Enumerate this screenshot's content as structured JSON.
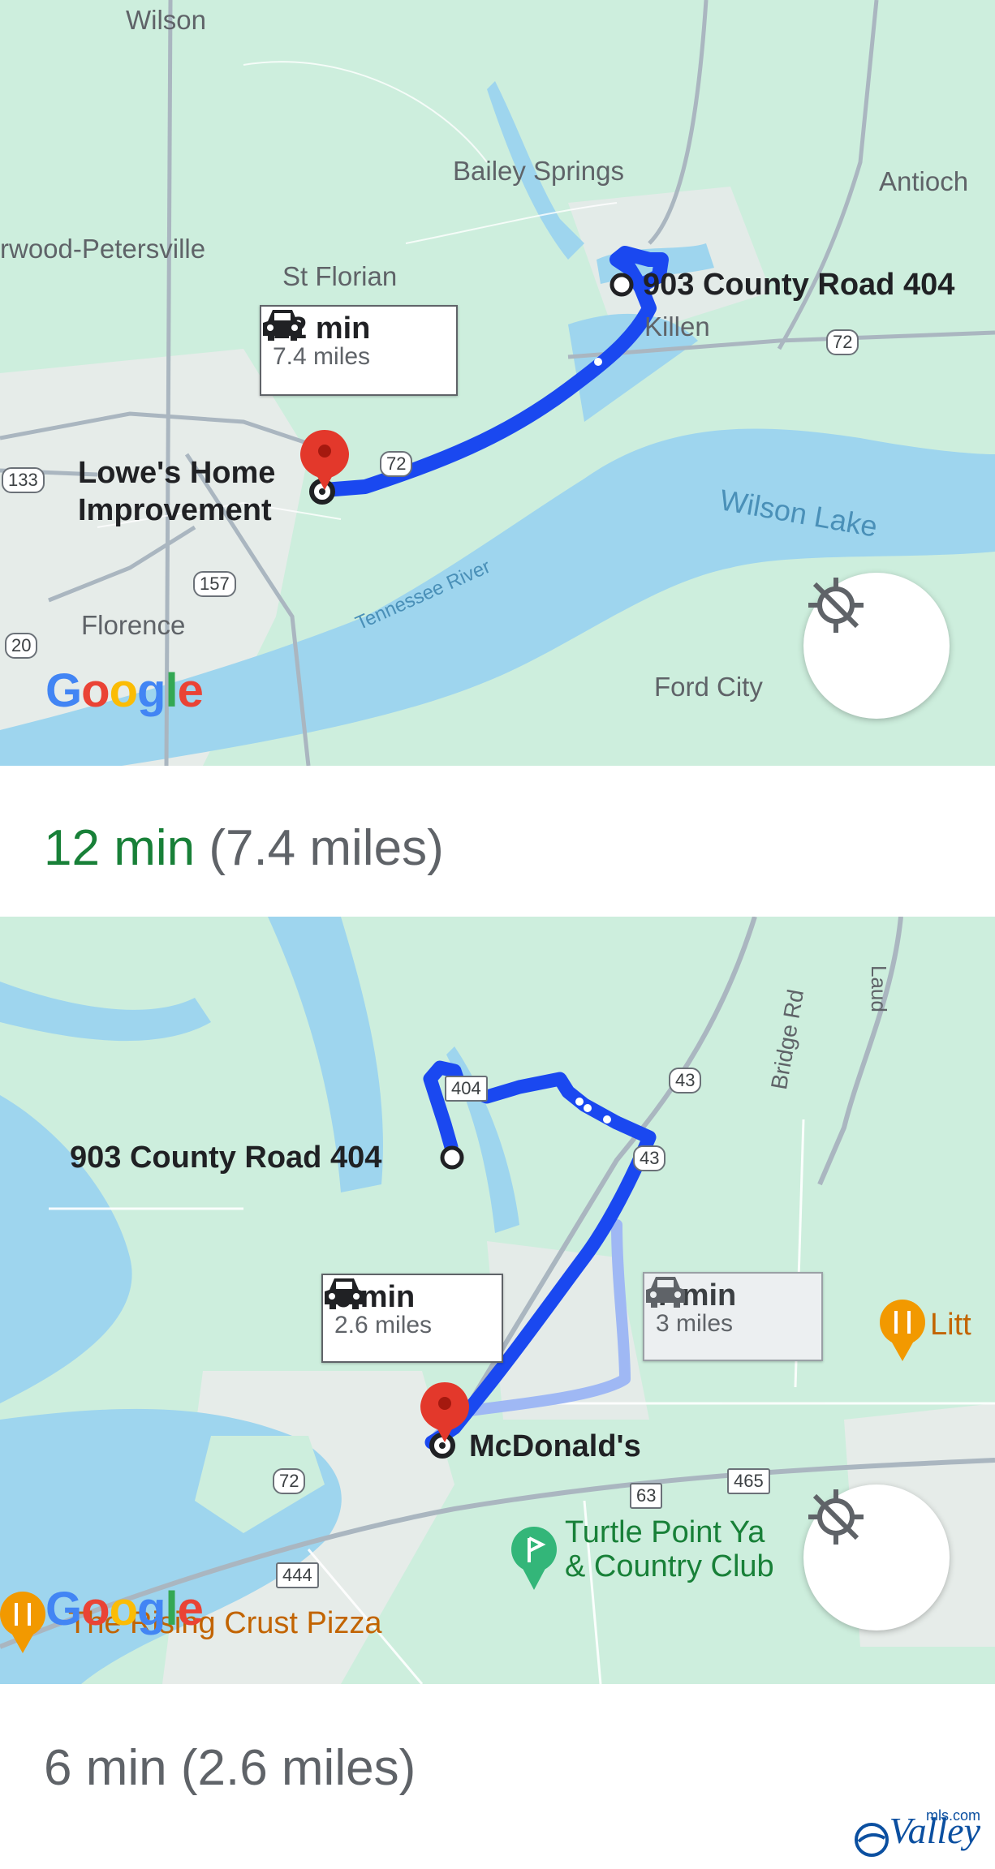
{
  "map1": {
    "place_labels": [
      "Wilson",
      "Bailey Springs",
      "Antioch",
      "rwood-Petersville",
      "St Florian",
      "Killen",
      "Florence",
      "Ford City"
    ],
    "water_labels": [
      "Wilson Lake",
      "Tennessee River"
    ],
    "shields": [
      "72",
      "72",
      "133",
      "157",
      "20"
    ],
    "destination_label": "903 County Road 404",
    "origin_label_line1": "Lowe's Home",
    "origin_label_line2": "Improvement",
    "route_callout": {
      "time": "12 min",
      "distance": "7.4 miles"
    },
    "logo": "Google",
    "location_button_icon": "location-disabled-icon"
  },
  "summary1": {
    "time": "12 min",
    "distance": "(7.4 miles)",
    "time_color": "#188038"
  },
  "map2": {
    "origin_label": "903 County Road 404",
    "destination_label": "McDonald's",
    "road_labels": [
      "Bridge Rd",
      "Laud"
    ],
    "shields": [
      "404",
      "43",
      "43",
      "72",
      "444",
      "63",
      "465"
    ],
    "poi_golf": {
      "line1": "Turtle Point Ya",
      "line2": "& Country Club"
    },
    "poi_restaurant_right": "Litt",
    "poi_pizza": "The Rising Crust Pizza",
    "route_callout": {
      "time": "6 min",
      "distance": "2.6 miles"
    },
    "alt_callout": {
      "time": "7 min",
      "distance": "3 miles"
    },
    "logo": "Google",
    "location_button_icon": "location-disabled-icon"
  },
  "summary2": {
    "time": "6 min",
    "distance": "(2.6 miles)"
  },
  "watermark": {
    "brand": "Valley",
    "suffix": "mls.com"
  },
  "colors": {
    "land": "#cdeedd",
    "water": "#9ed5ee",
    "route": "#1a48f0",
    "alt_route": "#9fb8f4",
    "pin": "#e3382b"
  }
}
